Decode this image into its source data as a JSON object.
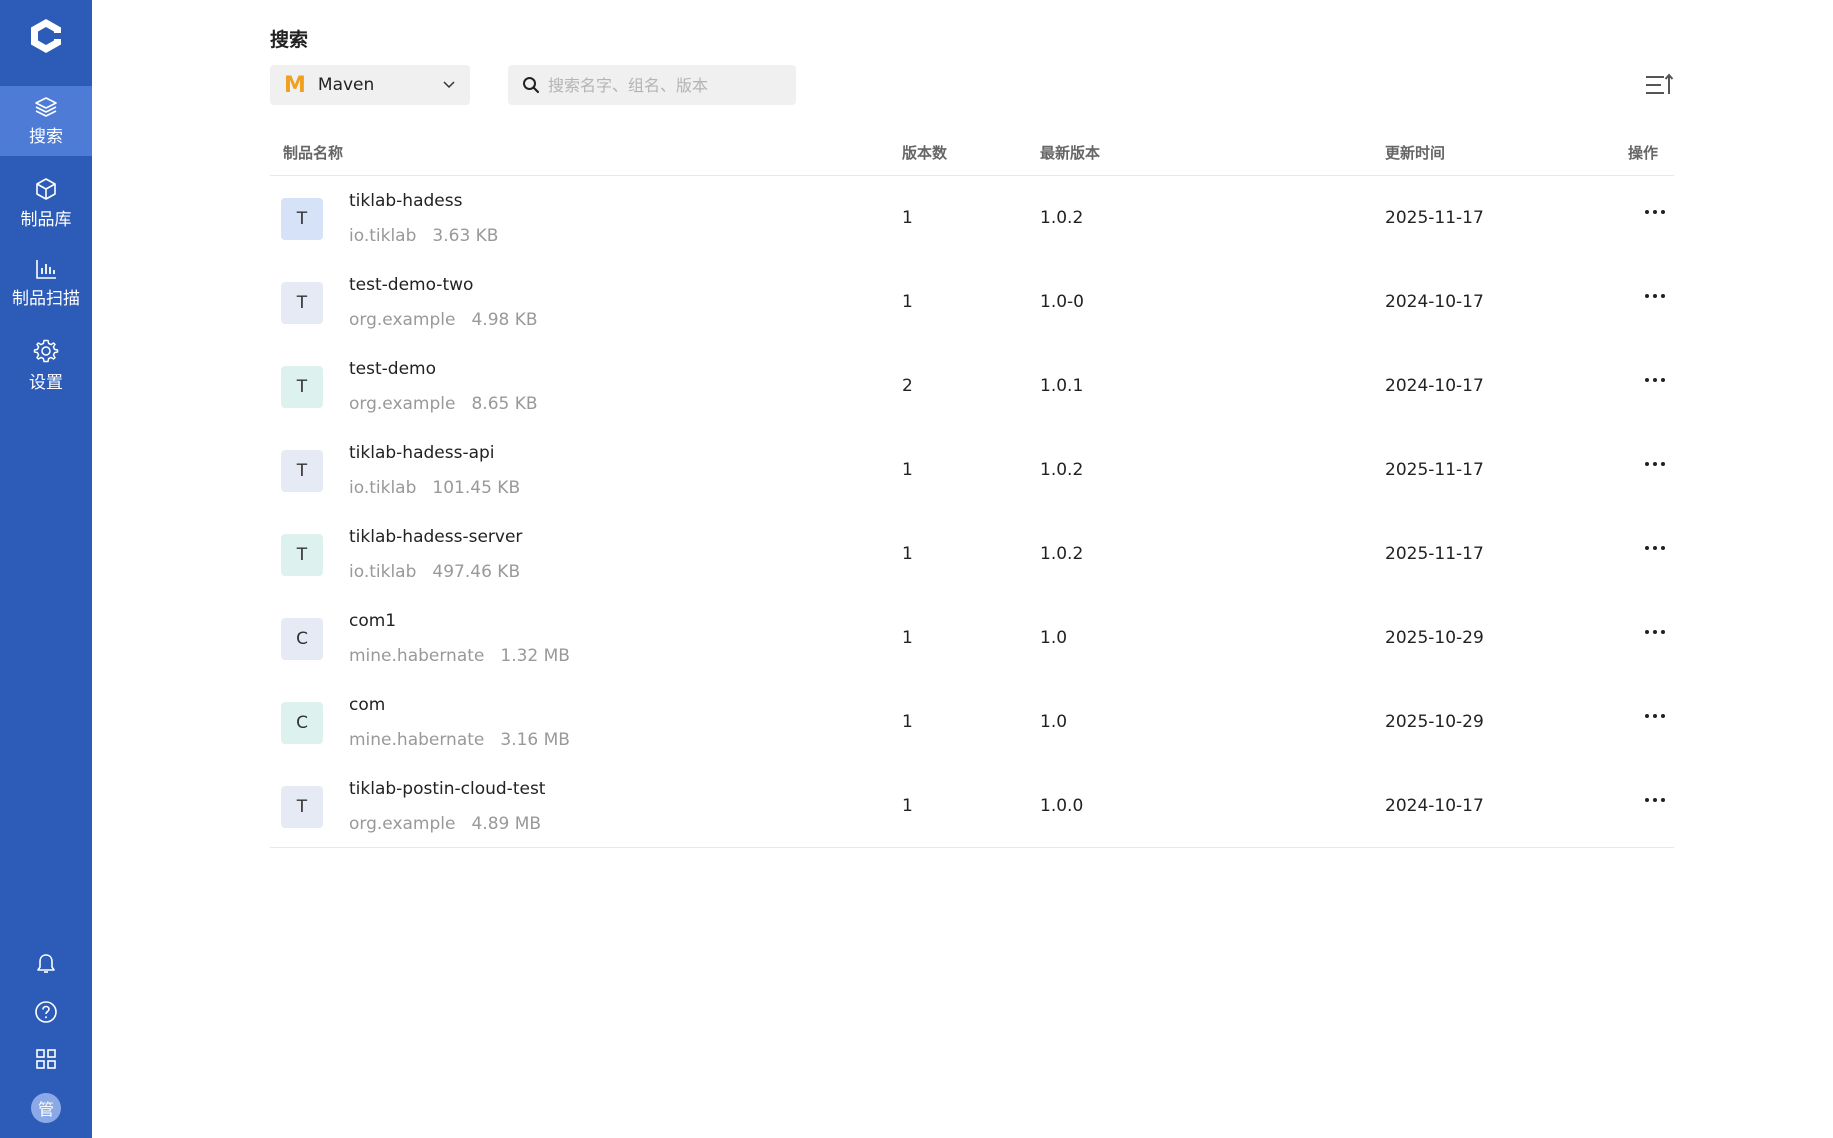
{
  "sidebar": {
    "nav": [
      {
        "label": "搜索",
        "icon": "layers-icon",
        "active": true
      },
      {
        "label": "制品库",
        "icon": "cube-icon",
        "active": false
      },
      {
        "label": "制品扫描",
        "icon": "bar-chart-icon",
        "active": false
      },
      {
        "label": "设置",
        "icon": "gear-icon",
        "active": false
      }
    ],
    "avatar_text": "管"
  },
  "header": {
    "title": "搜索",
    "repo_type": "Maven",
    "search_placeholder": "搜索名字、组名、版本"
  },
  "table": {
    "columns": {
      "name": "制品名称",
      "versions": "版本数",
      "latest": "最新版本",
      "updated": "更新时间",
      "actions": "操作"
    },
    "rows": [
      {
        "initial": "T",
        "name": "tiklab-hadess",
        "group": "io.tiklab",
        "size": "3.63 KB",
        "versions": "1",
        "latest": "1.0.2",
        "updated": "2025-11-17",
        "color": "#d6e2f8"
      },
      {
        "initial": "T",
        "name": "test-demo-two",
        "group": "org.example",
        "size": "4.98 KB",
        "versions": "1",
        "latest": "1.0-0",
        "updated": "2024-10-17",
        "color": "#e6eaf4"
      },
      {
        "initial": "T",
        "name": "test-demo",
        "group": "org.example",
        "size": "8.65 KB",
        "versions": "2",
        "latest": "1.0.1",
        "updated": "2024-10-17",
        "color": "#ddf2ef"
      },
      {
        "initial": "T",
        "name": "tiklab-hadess-api",
        "group": "io.tiklab",
        "size": "101.45 KB",
        "versions": "1",
        "latest": "1.0.2",
        "updated": "2025-11-17",
        "color": "#e6eaf4"
      },
      {
        "initial": "T",
        "name": "tiklab-hadess-server",
        "group": "io.tiklab",
        "size": "497.46 KB",
        "versions": "1",
        "latest": "1.0.2",
        "updated": "2025-11-17",
        "color": "#ddf2ef"
      },
      {
        "initial": "C",
        "name": "com1",
        "group": "mine.habernate",
        "size": "1.32 MB",
        "versions": "1",
        "latest": "1.0",
        "updated": "2025-10-29",
        "color": "#e6eaf4"
      },
      {
        "initial": "C",
        "name": "com",
        "group": "mine.habernate",
        "size": "3.16 MB",
        "versions": "1",
        "latest": "1.0",
        "updated": "2025-10-29",
        "color": "#ddf2ef"
      },
      {
        "initial": "T",
        "name": "tiklab-postin-cloud-test",
        "group": "org.example",
        "size": "4.89 MB",
        "versions": "1",
        "latest": "1.0.0",
        "updated": "2024-10-17",
        "color": "#e6eaf4"
      }
    ]
  }
}
